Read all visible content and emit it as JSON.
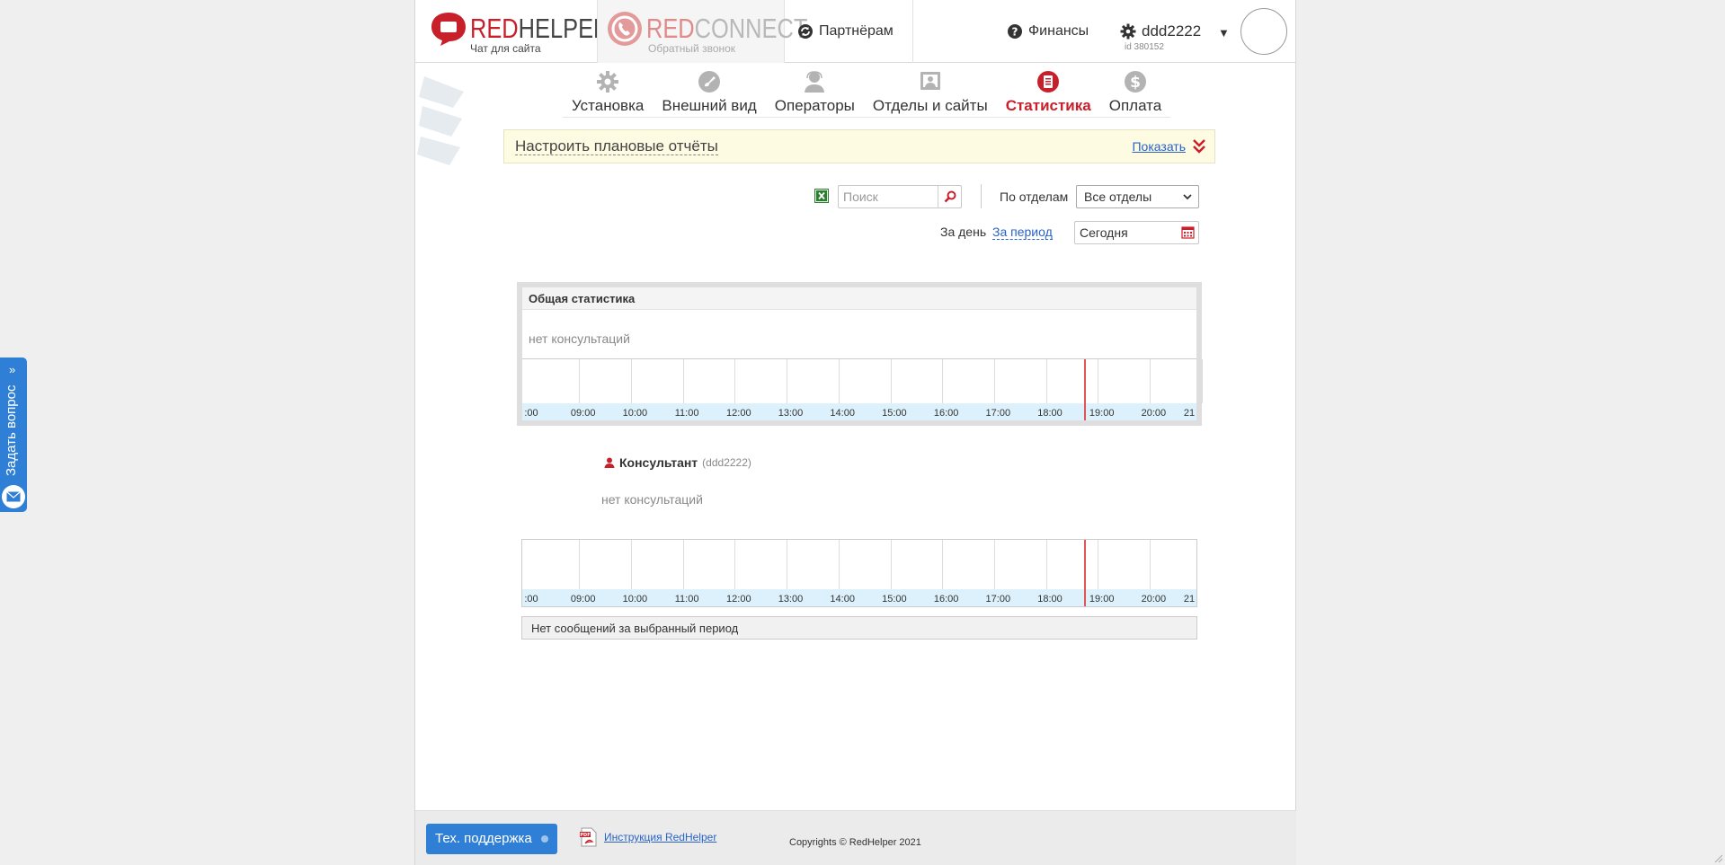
{
  "header": {
    "logo_main_red": "RED",
    "logo_main_grey": "HELPER",
    "logo_main_sub": "Чат для сайта",
    "logo_connect_red": "RED",
    "logo_connect_grey": "CONNECT",
    "logo_connect_sub": "Обратный звонок",
    "partners_label": "Партнёрам",
    "finance_label": "Финансы",
    "user_name": "ddd2222",
    "user_id": "id 380152"
  },
  "tabs": [
    {
      "label": "Установка",
      "icon": "gear-icon",
      "active": false
    },
    {
      "label": "Внешний вид",
      "icon": "brush-icon",
      "active": false
    },
    {
      "label": "Операторы",
      "icon": "operator-icon",
      "active": false
    },
    {
      "label": "Отделы и сайты",
      "icon": "department-icon",
      "active": false
    },
    {
      "label": "Статистика",
      "icon": "statistics-icon",
      "active": true
    },
    {
      "label": "Оплата",
      "icon": "dollar-icon",
      "active": false
    }
  ],
  "banner": {
    "title": "Настроить плановые отчёты",
    "show_label": "Показать"
  },
  "filters": {
    "search_placeholder": "Поиск",
    "dept_label": "По отделам",
    "dept_selected": "Все отделы",
    "day_label": "За день",
    "period_label": "За период",
    "date_value": "Сегодня"
  },
  "general_stats": {
    "title": "Общая статистика",
    "empty_text": "нет консультаций"
  },
  "timeline_labels": [
    ":00",
    "09:00",
    "10:00",
    "11:00",
    "12:00",
    "13:00",
    "14:00",
    "15:00",
    "16:00",
    "17:00",
    "18:00",
    "19:00",
    "20:00",
    "21"
  ],
  "consultant": {
    "name": "Консультант",
    "login": "(ddd2222)",
    "empty_text": "нет консультаций",
    "no_messages": "Нет сообщений за выбранный период"
  },
  "footer": {
    "support_label": "Тех. поддержка",
    "manual_label": "Инструкция RedHelper",
    "copyright": "Copyrights © RedHelper 2021"
  },
  "side_tab": {
    "label": "Задать вопрос"
  },
  "colors": {
    "brand_red": "#c8202a",
    "accent_blue": "#2f7fd6",
    "link_blue": "#2a63c8"
  }
}
